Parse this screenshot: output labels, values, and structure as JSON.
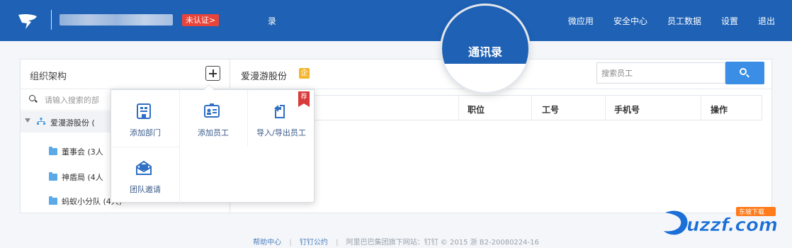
{
  "header": {
    "cert_badge": "未认证>",
    "nav_partial": "录",
    "nav": [
      "微应用",
      "安全中心",
      "员工数据",
      "设置",
      "退出"
    ]
  },
  "magnifier": {
    "label": "通讯录"
  },
  "left": {
    "title": "组织架构",
    "search_placeholder": "请输入搜索的部",
    "root": "爱漫游股份 (",
    "items": [
      "董事会 (3人",
      "神盾局 (4人",
      "蚂蚁小分队 (4人)"
    ]
  },
  "right": {
    "org_name": "爱漫游股份",
    "gold_badge": "企",
    "search_placeholder": "搜索员工",
    "columns": [
      "职位",
      "工号",
      "手机号",
      "操作"
    ]
  },
  "popup": {
    "items": [
      "添加部门",
      "添加员工",
      "导入/导出员工",
      "团队邀请"
    ],
    "ribbon": "荐"
  },
  "footer": {
    "help": "帮助中心",
    "terms": "钉钉公约",
    "info": "阿里巴巴集团旗下网站：钉钉 © 2015 浙 B2-20080224-16"
  },
  "watermark": {
    "text": "uzzf.com",
    "badge": "东坡下载"
  },
  "colors": {
    "brand": "#1e61b5",
    "accent": "#3a8ee6",
    "badge": "#e8443a"
  }
}
